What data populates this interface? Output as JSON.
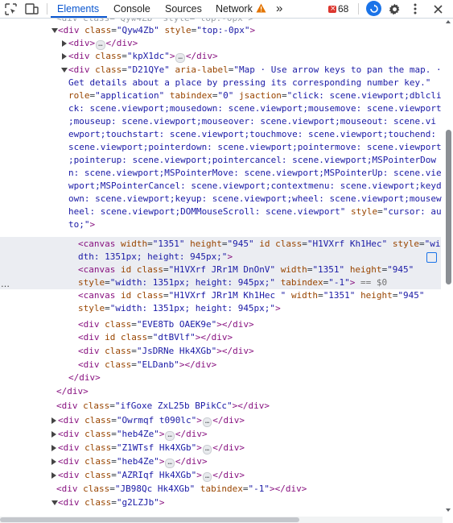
{
  "toolbar": {
    "tabs": [
      {
        "label": "Elements"
      },
      {
        "label": "Console"
      },
      {
        "label": "Sources"
      },
      {
        "label": "Network"
      }
    ],
    "more": "»",
    "error_count": "68",
    "colors": {
      "accent": "#0b57d0",
      "warning": "#e37400",
      "error": "#dc362e"
    }
  },
  "tree": {
    "l1": {
      "tag": "div",
      "an": "class",
      "av": "\"Qyw4Zb\"",
      "an2": "style",
      "av2": "\"top:-0px\""
    },
    "l2": {
      "tag": "div"
    },
    "l3": {
      "tag": "div",
      "an": "class",
      "av": "\"kpX1dc\""
    },
    "l4": {
      "tag": "div",
      "an": "class",
      "av": "\"D21QYe\"",
      "an2": "aria-label",
      "av2": "\"Map · Use arrow keys to pan the map. ·"
    },
    "l5": "Get details about a place by pressing its corresponding number key.\"",
    "l6": {
      "an": "role",
      "av": "\"application\"",
      "an2": "tabindex",
      "av2": "\"0\"",
      "an3": "jsaction",
      "av3": "\"click: scene.viewport;dblcli"
    },
    "l7": "ck: scene.viewport;mousedown: scene.viewport;mousemove: scene.viewport",
    "l8": ";mouseup: scene.viewport;mouseover: scene.viewport;mouseout: scene.vi",
    "l9": "ewport;touchstart: scene.viewport;touchmove: scene.viewport;touchend:",
    "l10": "scene.viewport;pointerdown: scene.viewport;pointermove: scene.viewport",
    "l11": ";pointerup: scene.viewport;pointercancel: scene.viewport;MSPointerDow",
    "l12": "n: scene.viewport;MSPointerMove: scene.viewport;MSPointerUp: scene.vie",
    "l13": "wport;MSPointerCancel: scene.viewport;contextmenu: scene.viewport;keyd",
    "l14": "own: scene.viewport;keyup: scene.viewport;wheel: scene.viewport;mousew",
    "l15": "heel: scene.viewport;DOMMouseScroll: scene.viewport\"",
    "l15_an": "style",
    "l15_av": "\"cursor: au",
    "l16": "to;\"",
    "l17": {
      "tag": "canvas",
      "an": "width",
      "av": "\"1351\"",
      "an2": "height",
      "av2": "\"945\"",
      "an3": "id class",
      "av3": "\"H1VXrf Kh1Hec\"",
      "an4": "style",
      "av4": "\"wi"
    },
    "l18": "dth: 1351px; height: 945px;\"",
    "l19": {
      "tag": "canvas",
      "an": "id class",
      "av": "\"H1VXrf JRr1M DnOnV\"",
      "an2": "width",
      "av2": "\"1351\"",
      "an3": "height",
      "av3": "\"945\""
    },
    "l20": {
      "an": "style",
      "av": "\"width: 1351px; height: 945px;\"",
      "an2": "tabindex",
      "av2": "\"-1\"",
      "d0": "== $0"
    },
    "l21": {
      "tag": "canvas",
      "an": "id class",
      "av": "\"H1VXrf JRr1M Kh1Hec \"",
      "an2": "width",
      "av2": "\"1351\"",
      "an3": "height",
      "av3": "\"945\""
    },
    "l22": {
      "an": "style",
      "av": "\"width: 1351px; height: 945px;\""
    },
    "l23": {
      "tag": "div",
      "an": "class",
      "av": "\"EVE8Tb OAEK9e\""
    },
    "l24": {
      "tag": "div",
      "an": "id class",
      "av": "\"dtBVlf\""
    },
    "l25": {
      "tag": "div",
      "an": "class",
      "av": "\"JsDRNe Hk4XGb\""
    },
    "l26": {
      "tag": "div",
      "an": "class",
      "av": "\"ELDanb\""
    },
    "l27": {
      "tag": "div"
    },
    "l28": {
      "tag": "div"
    },
    "l29": {
      "tag": "div",
      "an": "class",
      "av": "\"ifGoxe ZxL25b BPikCc\""
    },
    "l30": {
      "tag": "div",
      "an": "class",
      "av": "\"Owrmqf t090lc\""
    },
    "l31": {
      "tag": "div",
      "an": "class",
      "av": "\"heb4Ze\""
    },
    "l32": {
      "tag": "div",
      "an": "class",
      "av": "\"Z1WTsf Hk4XGb\""
    },
    "l33": {
      "tag": "div",
      "an": "class",
      "av": "\"heb4Ze\""
    },
    "l34": {
      "tag": "div",
      "an": "class",
      "av": "\"AZRIqf Hk4XGb\""
    },
    "l35": {
      "tag": "div",
      "an": "class",
      "av": "\"JB98Qc Hk4XGb\"",
      "an2": "tabindex",
      "av2": "\"-1\""
    },
    "l36": {
      "tag": "div",
      "an": "class",
      "av": "\"g2LZJb\""
    },
    "ellipsis": "…",
    "dots": "…"
  }
}
